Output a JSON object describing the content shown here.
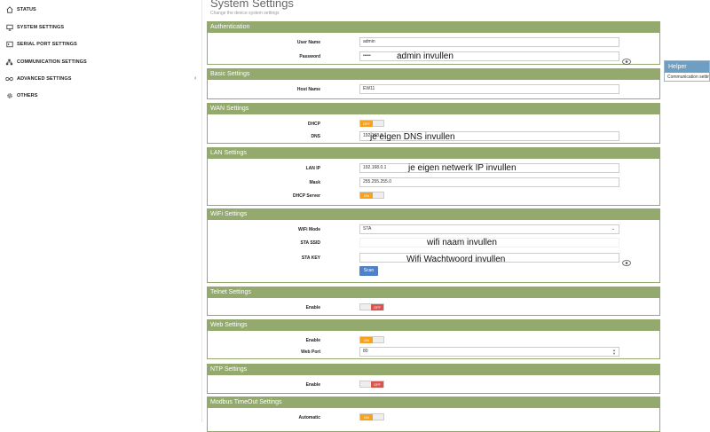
{
  "sidebar": {
    "items": [
      {
        "label": "STATUS",
        "icon": "home-icon"
      },
      {
        "label": "SYSTEM SETTINGS",
        "icon": "monitor-icon"
      },
      {
        "label": "SERIAL PORT SETTINGS",
        "icon": "terminal-icon"
      },
      {
        "label": "COMMUNICATION SETTINGS",
        "icon": "network-icon"
      },
      {
        "label": "ADVANCED SETTINGS",
        "icon": "infinity-icon"
      },
      {
        "label": "OTHERS",
        "icon": "gear-icon"
      }
    ],
    "collapse_glyph": "‹"
  },
  "page": {
    "title": "System Settings",
    "subtitle": "Change the device system settings"
  },
  "authentication": {
    "title": "Authentication",
    "user_label": "User Name",
    "user_value": "admin",
    "pass_label": "Password",
    "pass_value": "•••••",
    "annotation": "admin  invullen"
  },
  "basic": {
    "title": "Basic Settings",
    "host_label": "Host Name",
    "host_value": "EW11"
  },
  "wan": {
    "title": "WAN Settings",
    "dhcp_label": "DHCP",
    "dhcp_toggle": "OFF",
    "dns_label": "DNS",
    "dns_value": "192.168.0.1",
    "annotation": "je eigen DNS invullen"
  },
  "lan": {
    "title": "LAN Settings",
    "ip_label": "LAN IP",
    "ip_value": "192.168.0.1",
    "mask_label": "Mask",
    "mask_value": "255.255.255.0",
    "dhcp_server_label": "DHCP Server",
    "dhcp_server_toggle": "ON",
    "annotation": "je eigen netwerk IP invullen"
  },
  "wifi": {
    "title": "WiFi Settings",
    "mode_label": "WiFi Mode",
    "mode_value": "STA",
    "ssid_label": "STA SSID",
    "ssid_value": "",
    "key_label": "STA KEY",
    "key_value": "",
    "scan_label": "Scan",
    "ssid_annotation": "wifi naam invullen",
    "key_annotation": "Wifi Wachtwoord invullen"
  },
  "telnet": {
    "title": "Telnet Settings",
    "enable_label": "Enable",
    "enable_toggle": "OFF"
  },
  "web": {
    "title": "Web Settings",
    "enable_label": "Enable",
    "enable_toggle": "ON",
    "port_label": "Web Port",
    "port_value": "80"
  },
  "ntp": {
    "title": "NTP Settings",
    "enable_label": "Enable",
    "enable_toggle": "OFF"
  },
  "modbus": {
    "title": "Modbus TimeOut Settings",
    "auto_label": "Automatic",
    "auto_toggle": "ON"
  },
  "helper": {
    "title": "Helper",
    "body": "Communication setting"
  },
  "colors": {
    "panel_header": "#93a96e",
    "toggle_on": "#f6a21e",
    "toggle_off": "#d9534f",
    "scan_button": "#4f81c7",
    "helper_header": "#6e9ec2"
  }
}
